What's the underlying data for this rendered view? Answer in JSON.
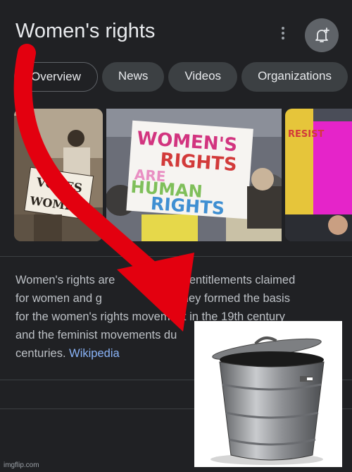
{
  "header": {
    "title": "Women's rights"
  },
  "tabs": [
    {
      "label": "Overview",
      "active": true
    },
    {
      "label": "News",
      "active": false
    },
    {
      "label": "Videos",
      "active": false
    },
    {
      "label": "Organizations",
      "active": false
    }
  ],
  "images": [
    {
      "sign_text_1": "VOTES",
      "sign_text_2": "FOR",
      "sign_text_3": "WOMEN"
    },
    {
      "sign_text_1": "WOMEN'S",
      "sign_text_2": "RIGHTS",
      "sign_text_3": "ARE",
      "sign_text_4": "HUMAN",
      "sign_text_5": "RIGHTS"
    },
    {
      "sign_text_1": "RESIST"
    }
  ],
  "description": {
    "text_line1": "Women's rights are",
    "text_line1b": "s and entitlements claimed",
    "text_line2": "for women and g",
    "text_line2b": "de. They formed the basis",
    "text_line3": "for the women's rights mov",
    "text_line3b": "ement in the 19th century",
    "text_line4": "and the feminist movements du",
    "text_line5": "centuries.",
    "source_link": "Wikipedia"
  },
  "watermark": "imgflip.com",
  "colors": {
    "background": "#202124",
    "link": "#8ab4f8",
    "arrow": "#e3000f"
  }
}
